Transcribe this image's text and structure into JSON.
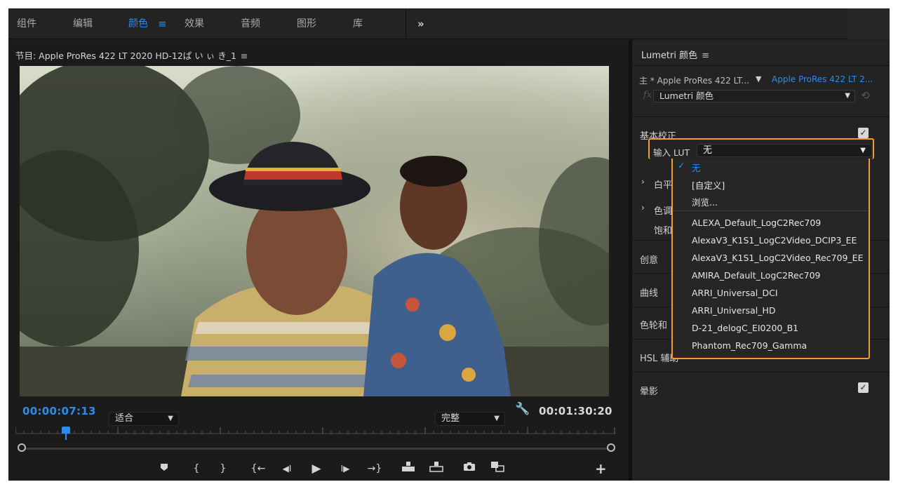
{
  "workspace_tabs": [
    {
      "label": "组件",
      "active": false
    },
    {
      "label": "编辑",
      "active": false
    },
    {
      "label": "颜色",
      "active": true
    },
    {
      "label": "效果",
      "active": false
    },
    {
      "label": "音频",
      "active": false
    },
    {
      "label": "图形",
      "active": false
    },
    {
      "label": "库",
      "active": false
    }
  ],
  "workspace_menu_icon": "≡",
  "workspace_more_icon": "»",
  "program": {
    "title": "节目: Apple ProRes 422 LT 2020 HD-12ぱ い ぃ き_1",
    "menu_icon": "≡",
    "current_timecode": "00:00:07:13",
    "fit_label": "适合",
    "quality_label": "完整",
    "duration_timecode": "00:01:30:20",
    "settings_icon": "wrench-icon",
    "transport": {
      "marker": "marker-icon",
      "mark_in": "{",
      "mark_out": "}",
      "go_to_in": "{←",
      "step_back": "◀I",
      "play": "▶",
      "step_forward": "I▶",
      "go_to_out": "→}",
      "lift": "lift-icon",
      "extract": "extract-icon",
      "export_frame": "camera-icon",
      "compare_view": "compare-icon",
      "add_button": "+"
    }
  },
  "lumetri": {
    "title": "Lumetri 颜色",
    "menu_icon": "≡",
    "master_clip": "主 * Apple ProRes 422 LT...",
    "active_clip": "Apple ProRes 422 LT 2...",
    "effect_name": "Lumetri 颜色",
    "fx_label": "fx",
    "sections": {
      "basic_correction": "基本校正",
      "creative": "创意",
      "curves": "曲线",
      "color_wheels": "色轮和",
      "hsl": "HSL 辅助",
      "vignette": "晕影"
    },
    "basic_rows": {
      "white_balance": "白平",
      "tone": "色调",
      "saturation": "饱和"
    },
    "input_lut": {
      "label": "输入 LUT",
      "value": "无",
      "options_top": [
        "无",
        "[自定义]",
        "浏览..."
      ],
      "options_luts": [
        "ALEXA_Default_LogC2Rec709",
        "AlexaV3_K1S1_LogC2Video_DCIP3_EE",
        "AlexaV3_K1S1_LogC2Video_Rec709_EE",
        "AMIRA_Default_LogC2Rec709",
        "ARRI_Universal_DCI",
        "ARRI_Universal_HD",
        "D-21_delogC_EI0200_B1",
        "Phantom_Rec709_Gamma"
      ]
    }
  },
  "colors": {
    "accent": "#2d8ceb",
    "highlight": "#f29b2e",
    "panel": "#232323"
  }
}
